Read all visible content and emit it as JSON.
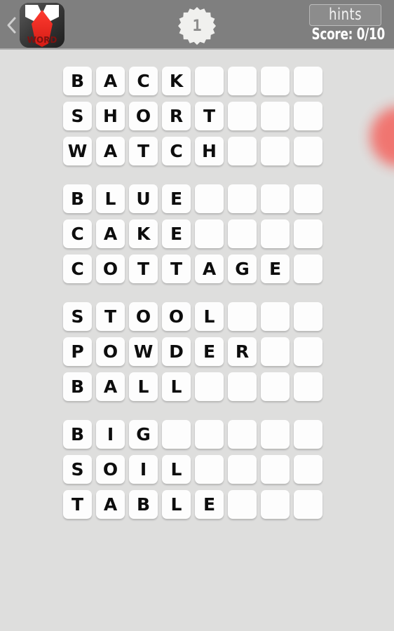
{
  "header": {
    "back_icon": "chevron-left-icon",
    "logo": {
      "icon": "word-tie-logo-icon",
      "label": "WORD"
    },
    "level_badge": {
      "icon": "starburst-badge-icon",
      "value": "1"
    },
    "hints_label": "hints",
    "score_label": "Score: 0/10",
    "background_color": "#7f7f7f"
  },
  "decor": {
    "blob_color": "#f2706b",
    "name": "red-circle-decoration"
  },
  "board": {
    "background_color": "#dededd",
    "tile_color": "#fdfdfd",
    "tile_text_color": "#0d0d0d",
    "columns": 8,
    "groups": [
      {
        "index": 1,
        "rows": [
          {
            "word": "BACK",
            "letters": [
              "B",
              "A",
              "C",
              "K",
              "",
              "",
              "",
              ""
            ]
          },
          {
            "word": "SHORT",
            "letters": [
              "S",
              "H",
              "O",
              "R",
              "T",
              "",
              "",
              ""
            ]
          },
          {
            "word": "WATCH",
            "letters": [
              "W",
              "A",
              "T",
              "C",
              "H",
              "",
              "",
              ""
            ]
          }
        ]
      },
      {
        "index": 2,
        "rows": [
          {
            "word": "BLUE",
            "letters": [
              "B",
              "L",
              "U",
              "E",
              "",
              "",
              "",
              ""
            ]
          },
          {
            "word": "CAKE",
            "letters": [
              "C",
              "A",
              "K",
              "E",
              "",
              "",
              "",
              ""
            ]
          },
          {
            "word": "COTTAGE",
            "letters": [
              "C",
              "O",
              "T",
              "T",
              "A",
              "G",
              "E",
              ""
            ]
          }
        ]
      },
      {
        "index": 3,
        "rows": [
          {
            "word": "STOOL",
            "letters": [
              "S",
              "T",
              "O",
              "O",
              "L",
              "",
              "",
              ""
            ]
          },
          {
            "word": "POWDER",
            "letters": [
              "P",
              "O",
              "W",
              "D",
              "E",
              "R",
              "",
              ""
            ]
          },
          {
            "word": "BALL",
            "letters": [
              "B",
              "A",
              "L",
              "L",
              "",
              "",
              "",
              ""
            ]
          }
        ]
      },
      {
        "index": 4,
        "rows": [
          {
            "word": "BIG",
            "letters": [
              "B",
              "I",
              "G",
              "",
              "",
              "",
              "",
              ""
            ]
          },
          {
            "word": "SOIL",
            "letters": [
              "S",
              "O",
              "I",
              "L",
              "",
              "",
              "",
              ""
            ]
          },
          {
            "word": "TABLE",
            "letters": [
              "T",
              "A",
              "B",
              "L",
              "E",
              "",
              "",
              ""
            ]
          }
        ]
      }
    ]
  }
}
